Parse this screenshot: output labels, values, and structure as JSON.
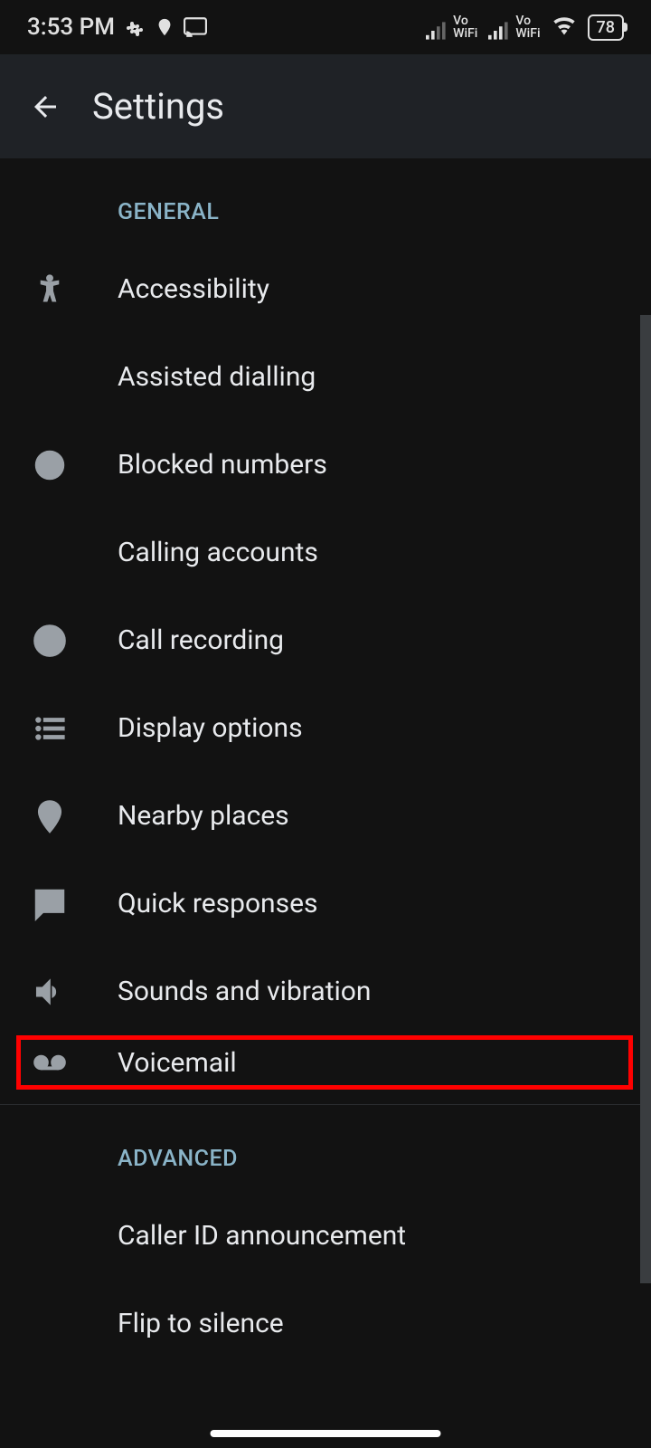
{
  "status_bar": {
    "time": "3:53 PM",
    "battery": "78"
  },
  "header": {
    "title": "Settings"
  },
  "sections": {
    "general": {
      "label": "GENERAL",
      "items": {
        "accessibility": "Accessibility",
        "assisted_dialling": "Assisted dialling",
        "blocked_numbers": "Blocked numbers",
        "calling_accounts": "Calling accounts",
        "call_recording": "Call recording",
        "display_options": "Display options",
        "nearby_places": "Nearby places",
        "quick_responses": "Quick responses",
        "sounds_vibration": "Sounds and vibration",
        "voicemail": "Voicemail"
      }
    },
    "advanced": {
      "label": "ADVANCED",
      "items": {
        "caller_id": "Caller ID announcement",
        "flip_to_silence": "Flip to silence"
      }
    }
  }
}
